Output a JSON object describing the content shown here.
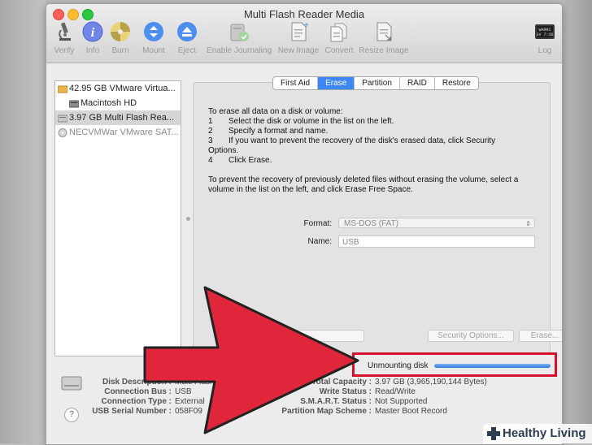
{
  "window": {
    "title": "Multi Flash Reader Media"
  },
  "toolbar": {
    "verify": "Verify",
    "info": "Info",
    "burn": "Burn",
    "mount": "Mount",
    "eject": "Eject",
    "enable_journaling": "Enable Journaling",
    "new_image": "New Image",
    "convert": "Convert",
    "resize_image": "Resize Image",
    "log": "Log",
    "log_icon_text": "WARNI\n3V 7:36"
  },
  "sidebar": {
    "items": [
      {
        "label": "42.95 GB VMware Virtua...",
        "icon": "hard-drive-icon"
      },
      {
        "label": "Macintosh HD",
        "icon": "volume-icon"
      },
      {
        "label": "3.97 GB Multi Flash Rea...",
        "icon": "usb-drive-icon",
        "selected": true
      },
      {
        "label": "NECVMWar VMware SAT...",
        "icon": "optical-drive-icon"
      }
    ]
  },
  "tabs": [
    "First Aid",
    "Erase",
    "Partition",
    "RAID",
    "Restore"
  ],
  "active_tab": "Erase",
  "erase": {
    "intro": "To erase all data on a disk or volume:",
    "steps": [
      {
        "n": "1",
        "text": "Select the disk or volume in the list on the left."
      },
      {
        "n": "2",
        "text": "Specify a format and name."
      },
      {
        "n": "3",
        "text": "If you want to prevent the recovery of the disk's erased data, click Security"
      },
      {
        "n": "",
        "text": "Options."
      },
      {
        "n": "4",
        "text": "Click Erase."
      }
    ],
    "note_line1": "To prevent the recovery of previously deleted files without erasing the volume, select a",
    "note_line2": "volume in the list on the left, and click Erase Free Space.",
    "format_label": "Format:",
    "format_value": "MS-DOS (FAT)",
    "name_label": "Name:",
    "name_value": "USB",
    "security_options": "Security Options...",
    "erase_button": "Erase..."
  },
  "progress": {
    "label": "Unmounting disk",
    "fraction": 1.0
  },
  "info": {
    "left": [
      {
        "key": "Disk Description :",
        "value": "Multi Flash"
      },
      {
        "key": "Connection Bus :",
        "value": "USB"
      },
      {
        "key": "Connection Type :",
        "value": "External"
      },
      {
        "key": "USB Serial Number :",
        "value": "058F09"
      }
    ],
    "right": [
      {
        "key": "Total Capacity :",
        "value": "3.97 GB (3,965,190,144 Bytes)"
      },
      {
        "key": "Write Status :",
        "value": "Read/Write"
      },
      {
        "key": "S.M.A.R.T. Status :",
        "value": "Not Supported"
      },
      {
        "key": "Partition Map Scheme :",
        "value": "Master Boot Record"
      }
    ]
  },
  "help": "?",
  "watermark": {
    "text": "Healthy Living"
  },
  "colors": {
    "arrow": "#e0263b",
    "highlight": "#d8102b",
    "accent": "#3d86f5"
  }
}
